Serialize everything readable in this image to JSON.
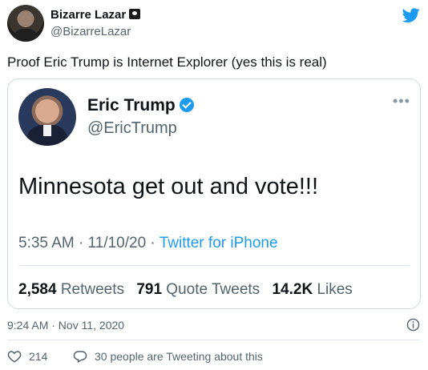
{
  "author": {
    "name": "Bizarre Lazar",
    "handle": "@BizarreLazar",
    "emoji_icon": "skull-crossbones-icon"
  },
  "tweet": {
    "text": "Proof Eric Trump is Internet Explorer (yes this is real)",
    "timestamp": "9:24 AM · Nov 11, 2020"
  },
  "embedded": {
    "name": "Eric Trump",
    "handle": "@EricTrump",
    "text": "Minnesota get out and vote!!!",
    "time": "5:35 AM · 11/10/20 · ",
    "source": "Twitter for iPhone",
    "retweets_count": "2,584",
    "retweets_label": "Retweets",
    "quotes_count": "791",
    "quotes_label": "Quote Tweets",
    "likes_count": "14.2K",
    "likes_label": "Likes",
    "more_label": "•••"
  },
  "actions": {
    "likes": "214",
    "conversation": "30 people are Tweeting about this"
  },
  "colors": {
    "twitter_blue": "#1d9bf0",
    "muted_text": "#536471",
    "border": "#cfd9de"
  }
}
